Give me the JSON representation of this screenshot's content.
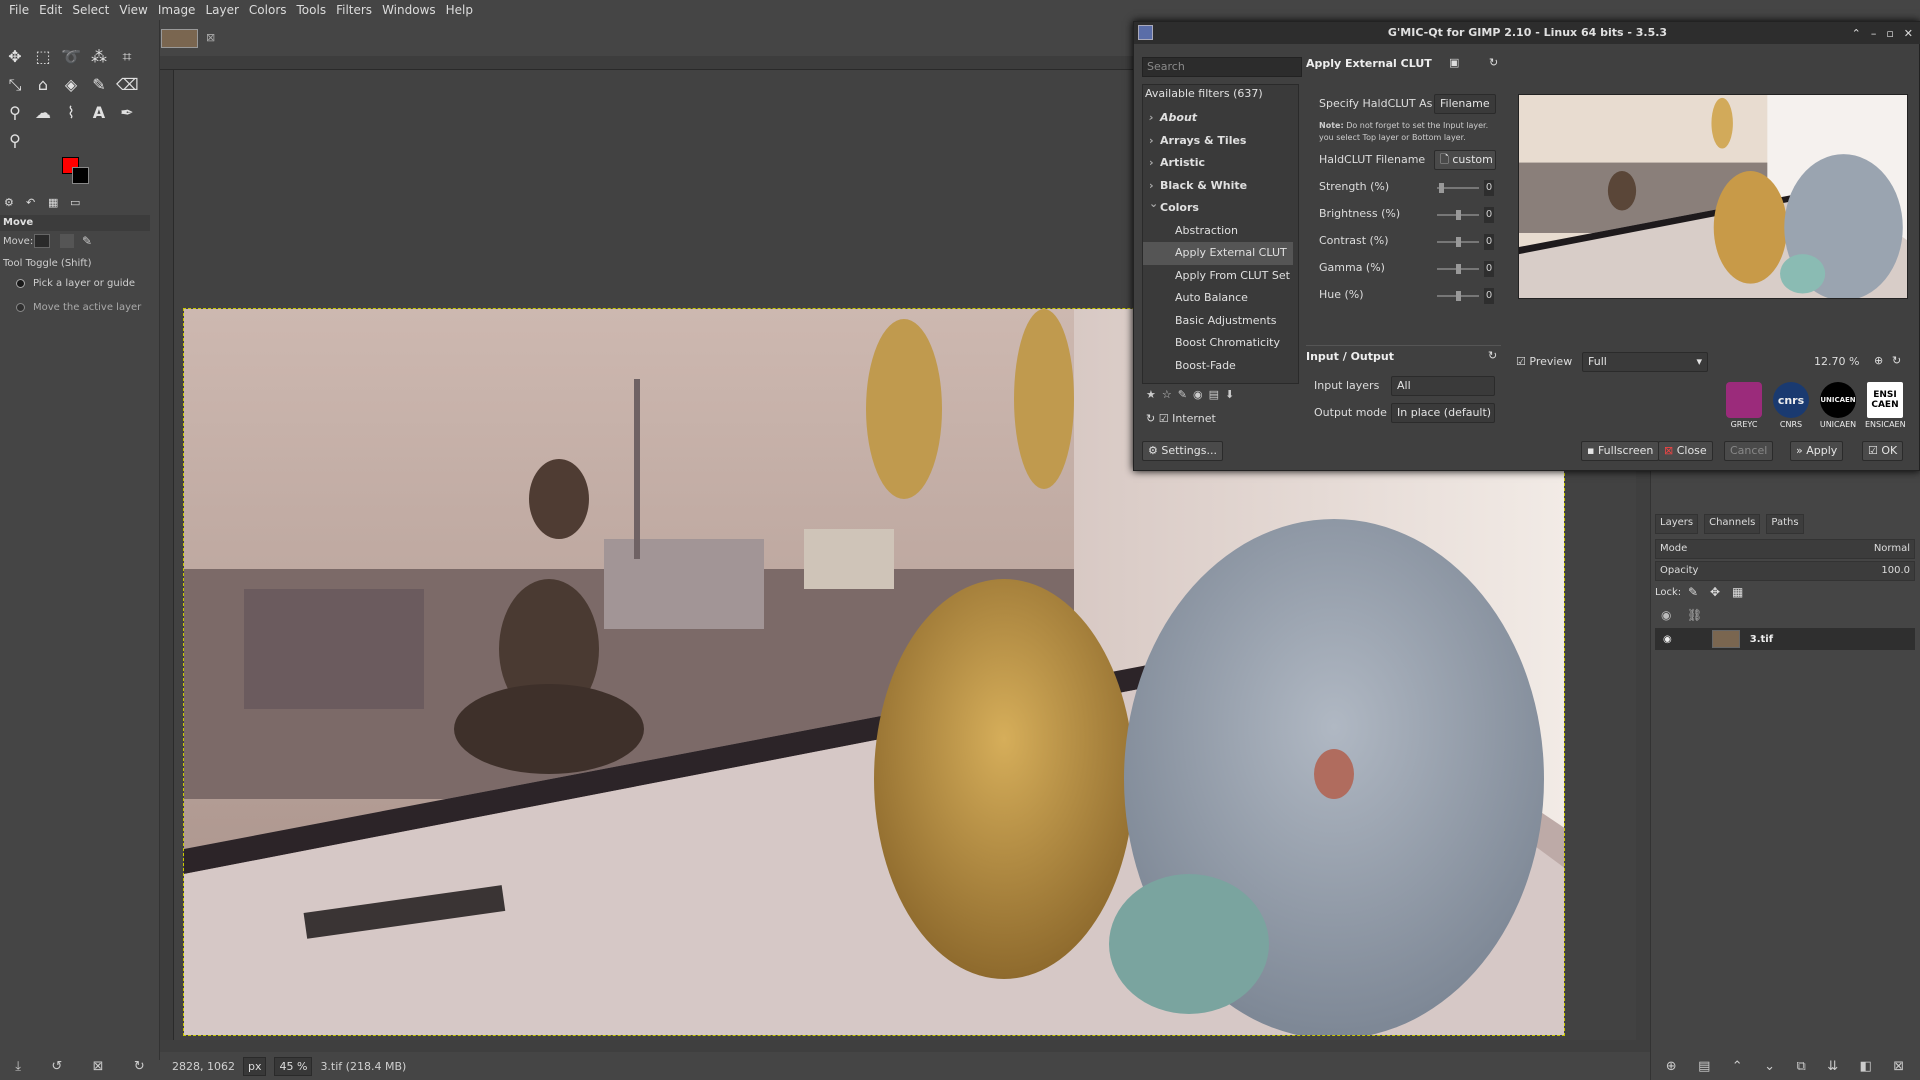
{
  "menubar": {
    "items": [
      "File",
      "Edit",
      "Select",
      "View",
      "Image",
      "Layer",
      "Colors",
      "Tools",
      "Filters",
      "Windows",
      "Help"
    ]
  },
  "toolbox": {
    "tool_options_title": "Move",
    "move_label": "Move:",
    "tool_toggle": "Tool Toggle (Shift)",
    "option_pick": "Pick a layer or guide",
    "option_move": "Move the active layer",
    "fg_color": "#ff0000",
    "bg_color": "#000000"
  },
  "status": {
    "coords": "2828, 1062",
    "unit": "px",
    "zoom": "45 %",
    "file": "3.tif (218.4 MB)"
  },
  "layers_dock": {
    "tabs": [
      "Layers",
      "Channels",
      "Paths"
    ],
    "mode_label": "Mode",
    "mode_value": "Normal",
    "opacity_label": "Opacity",
    "opacity_value": "100.0",
    "lock_label": "Lock:",
    "layer_name": "3.tif"
  },
  "gmic": {
    "title": "G'MIC-Qt for GIMP 2.10 - Linux 64 bits - 3.5.3",
    "search_placeholder": "Search",
    "available_filters": "Available filters (637)",
    "tree": [
      {
        "label": "About",
        "kind": "cat-ital"
      },
      {
        "label": "Arrays & Tiles",
        "kind": "cat"
      },
      {
        "label": "Artistic",
        "kind": "cat"
      },
      {
        "label": "Black & White",
        "kind": "cat"
      },
      {
        "label": "Colors",
        "kind": "cat-open"
      },
      {
        "label": "Abstraction",
        "kind": "sub"
      },
      {
        "label": "Apply External CLUT",
        "kind": "sub-sel"
      },
      {
        "label": "Apply From CLUT Set",
        "kind": "sub"
      },
      {
        "label": "Auto Balance",
        "kind": "sub"
      },
      {
        "label": "Basic Adjustments",
        "kind": "sub"
      },
      {
        "label": "Boost Chromaticity",
        "kind": "sub"
      },
      {
        "label": "Boost-Fade",
        "kind": "sub"
      }
    ],
    "internet_label": "Internet",
    "settings_label": "Settings...",
    "filter_title": "Apply External CLUT",
    "specify_label": "Specify HaldCLUT As",
    "specify_value": "Filename",
    "note_bold": "Note:",
    "note_text": "Do not forget to set the Input layer. you select Top layer or Bottom layer.",
    "haldclut_label": "HaldCLUT Filename",
    "haldclut_value": "custom",
    "params": [
      {
        "label": "Strength (%)",
        "value": "0",
        "level": 0.05
      },
      {
        "label": "Brightness (%)",
        "value": "0",
        "level": 0.5
      },
      {
        "label": "Contrast (%)",
        "value": "0",
        "level": 0.5
      },
      {
        "label": "Gamma (%)",
        "value": "0",
        "level": 0.5
      },
      {
        "label": "Hue (%)",
        "value": "0",
        "level": 0.5
      }
    ],
    "io_title": "Input / Output",
    "input_layers_label": "Input layers",
    "input_layers_value": "All",
    "output_mode_label": "Output mode",
    "output_mode_value": "In place (default)",
    "preview_label": "Preview",
    "preview_mode": "Full",
    "preview_zoom": "12.70 %",
    "logos": [
      "GREYC",
      "CNRS",
      "UNICAEN",
      "ENSICAEN"
    ],
    "logo_marks": [
      "",
      "cnrs",
      "UNICAEN",
      "ENSI CAEN"
    ],
    "buttons": {
      "fullscreen": "Fullscreen",
      "close": "Close",
      "cancel": "Cancel",
      "apply": "Apply",
      "ok": "OK"
    }
  }
}
